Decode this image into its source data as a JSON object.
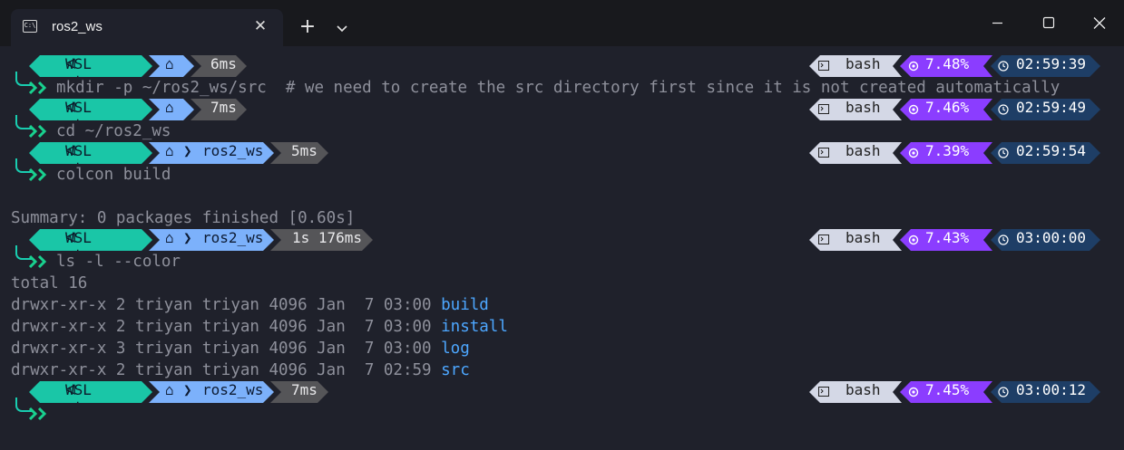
{
  "tabs": [
    {
      "title": "ros2_ws",
      "icon": "terminal-icon"
    }
  ],
  "prompt": {
    "host_label": "WSL at",
    "host_icon": "ᐊ",
    "home_icon": "⌂",
    "bash_label": "bash",
    "cpu_icon": "✵",
    "clock_icon": "◷",
    "colors": {
      "wsl": "#1ac6a7",
      "path": "#7cb1fb",
      "exec_time": "#555558",
      "shell": "#d4d8e6",
      "cpu": "#8b3dff",
      "clock": "#1e3e66",
      "connector": "#19cdb0"
    }
  },
  "prompts": [
    {
      "path": "",
      "exec_time": "6ms",
      "cpu": "7.48%",
      "clock": "02:59:39",
      "command": "mkdir -p ~/ros2_ws/src  # we need to create the src directory first since it is not created automatically"
    },
    {
      "path": "",
      "exec_time": "7ms",
      "cpu": "7.46%",
      "clock": "02:59:49",
      "command": "cd ~/ros2_ws"
    },
    {
      "path": "ros2_ws",
      "exec_time": "5ms",
      "cpu": "7.39%",
      "clock": "02:59:54",
      "command": "colcon build"
    },
    {
      "path": "ros2_ws",
      "exec_time": "1s 176ms",
      "cpu": "7.43%",
      "clock": "03:00:00",
      "command": "ls -l --color"
    },
    {
      "path": "ros2_ws",
      "exec_time": "7ms",
      "cpu": "7.45%",
      "clock": "03:00:12",
      "command": ""
    }
  ],
  "outputs": {
    "summary": "Summary: 0 packages finished [0.60s]",
    "total": "total 16",
    "listing": [
      {
        "meta": "drwxr-xr-x 2 triyan triyan 4096 Jan  7 03:00 ",
        "name": "build"
      },
      {
        "meta": "drwxr-xr-x 2 triyan triyan 4096 Jan  7 03:00 ",
        "name": "install"
      },
      {
        "meta": "drwxr-xr-x 3 triyan triyan 4096 Jan  7 03:00 ",
        "name": "log"
      },
      {
        "meta": "drwxr-xr-x 2 triyan triyan 4096 Jan  7 02:59 ",
        "name": "src"
      }
    ]
  }
}
